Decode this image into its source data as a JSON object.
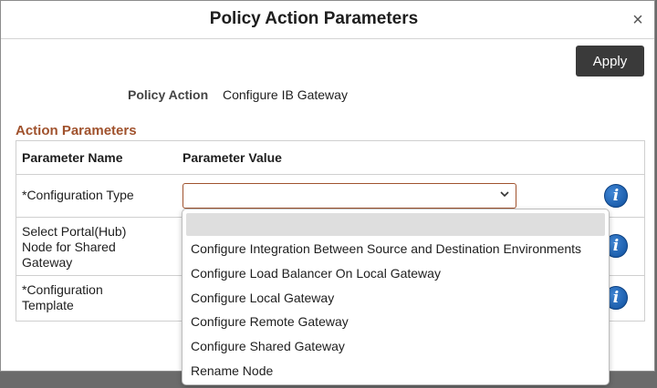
{
  "dialog": {
    "title": "Policy Action Parameters",
    "close_label": "×",
    "apply_label": "Apply"
  },
  "policy_action": {
    "label": "Policy Action",
    "value": "Configure IB Gateway"
  },
  "section_title": "Action Parameters",
  "grid": {
    "headers": [
      "Parameter Name",
      "Parameter Value"
    ],
    "rows": [
      {
        "name": "*Configuration Type"
      },
      {
        "name": "Select Portal(Hub) Node for Shared Gateway"
      },
      {
        "name": "*Configuration Template"
      }
    ],
    "info_glyph": "i"
  },
  "dropdown": {
    "options": [
      "",
      "Configure Integration Between Source and Destination Environments",
      "Configure Load Balancer On Local Gateway",
      "Configure Local Gateway",
      "Configure Remote Gateway",
      "Configure Shared Gateway",
      "Rename Node"
    ]
  },
  "colors": {
    "accent": "#a0522d",
    "apply_bg": "#3a3a3a",
    "info_blue": "#0f5fb5"
  }
}
